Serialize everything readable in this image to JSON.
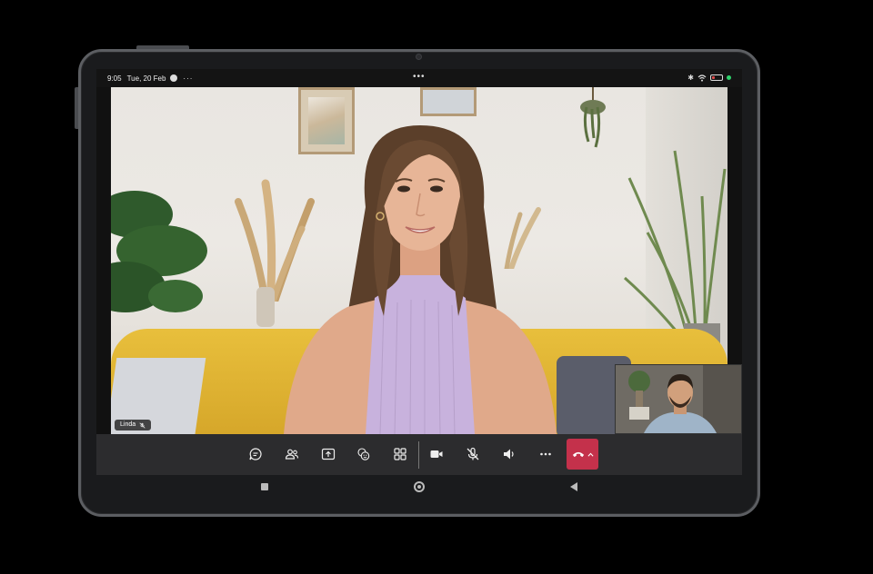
{
  "status_bar": {
    "time": "9:05",
    "date": "Tue, 20 Feb",
    "overflow_dots": "···",
    "center_dots": "•••",
    "battery_level_percent": 30,
    "battery_color": "#e14b4b",
    "indicator_color": "#2ed36c"
  },
  "call": {
    "main_participant_name": "Linda",
    "main_participant_muted": true,
    "controls": [
      {
        "name": "chat",
        "icon": "chat-bubble-icon"
      },
      {
        "name": "people",
        "icon": "people-icon"
      },
      {
        "name": "share",
        "icon": "share-screen-icon"
      },
      {
        "name": "reactions",
        "icon": "reactions-icon"
      },
      {
        "name": "view",
        "icon": "grid-view-icon"
      },
      {
        "name": "camera",
        "icon": "video-camera-icon"
      },
      {
        "name": "mic",
        "icon": "mic-off-icon"
      },
      {
        "name": "speaker",
        "icon": "speaker-icon"
      },
      {
        "name": "more",
        "icon": "more-icon"
      },
      {
        "name": "hang-up",
        "icon": "phone-hangup-icon"
      }
    ],
    "hangup_color": "#c4314b"
  },
  "nav_bar": {
    "buttons": [
      "recent-apps",
      "home",
      "back"
    ]
  }
}
